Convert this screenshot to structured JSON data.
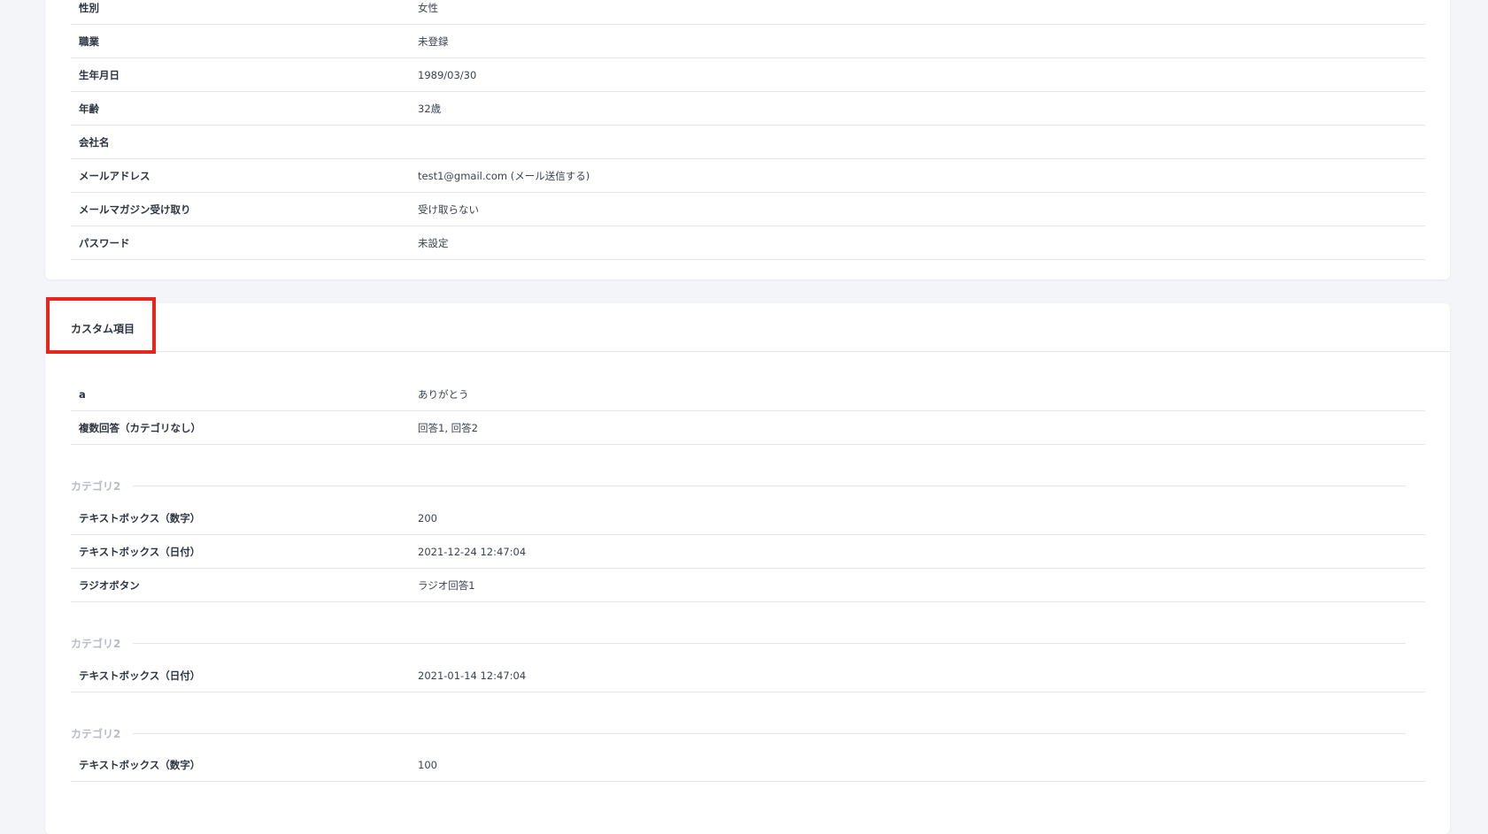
{
  "profile": {
    "rows": [
      {
        "label": "性別",
        "value": "女性"
      },
      {
        "label": "職業",
        "value": "未登録"
      },
      {
        "label": "生年月日",
        "value": "1989/03/30"
      },
      {
        "label": "年齢",
        "value": "32歳"
      },
      {
        "label": "会社名",
        "value": ""
      },
      {
        "label": "メールアドレス",
        "value": "test1@gmail.com (メール送信する)"
      },
      {
        "label": "メールマガジン受け取り",
        "value": "受け取らない"
      },
      {
        "label": "パスワード",
        "value": "未設定"
      }
    ]
  },
  "custom": {
    "title": "カスタム項目",
    "rows": [
      {
        "label": "a",
        "value": "ありがとう"
      },
      {
        "label": "複数回答（カテゴリなし）",
        "value": "回答1, 回答2"
      }
    ],
    "categories": [
      {
        "name": "カテゴリ2",
        "rows": [
          {
            "label": "テキストボックス（数字）",
            "value": "200"
          },
          {
            "label": "テキストボックス（日付）",
            "value": "2021-12-24 12:47:04"
          },
          {
            "label": "ラジオボタン",
            "value": "ラジオ回答1"
          }
        ]
      },
      {
        "name": "カテゴリ2",
        "rows": [
          {
            "label": "テキストボックス（日付）",
            "value": "2021-01-14 12:47:04"
          }
        ]
      },
      {
        "name": "カテゴリ2",
        "rows": [
          {
            "label": "テキストボックス（数字）",
            "value": "100"
          }
        ]
      }
    ]
  },
  "colors": {
    "highlight": "#e8251a",
    "category_text": "#b6bcc8",
    "background": "#f4f5f8"
  }
}
